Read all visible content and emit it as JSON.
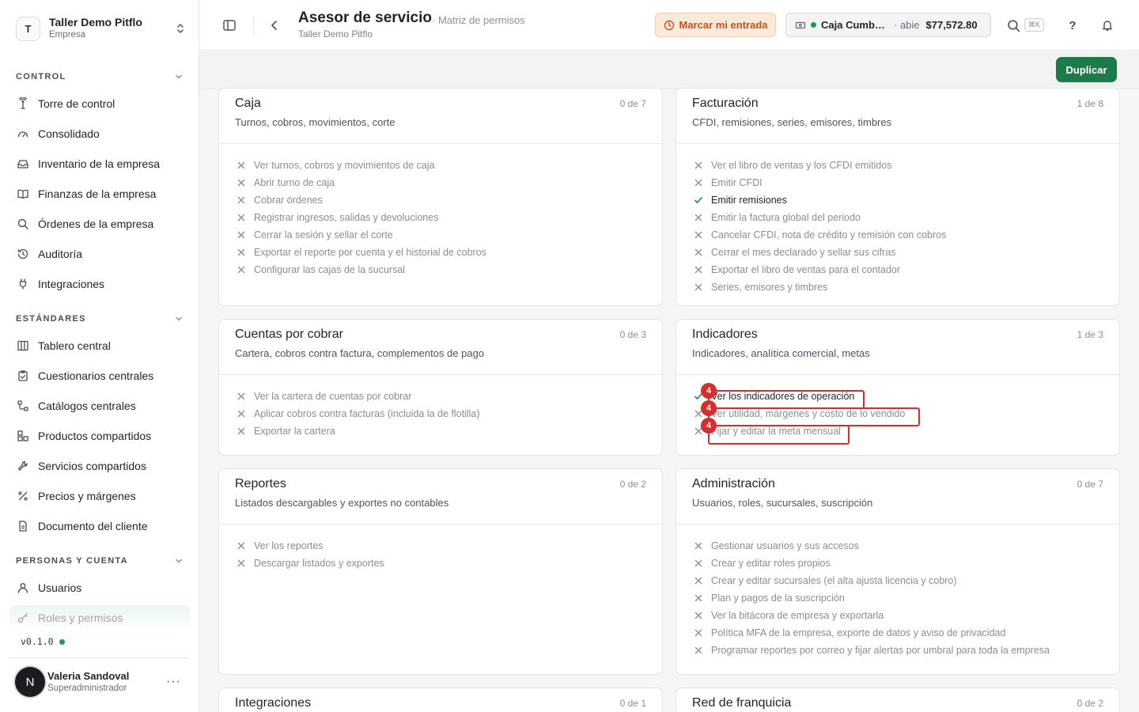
{
  "org": {
    "initial": "T",
    "name": "Taller Demo Pitflo",
    "type": "Empresa"
  },
  "sidebar": {
    "sections": [
      {
        "title": "CONTROL",
        "items": [
          "Torre de control",
          "Consolidado",
          "Inventario de la empresa",
          "Finanzas de la empresa",
          "Órdenes de la empresa",
          "Auditoría",
          "Integraciones"
        ]
      },
      {
        "title": "ESTÁNDARES",
        "items": [
          "Tablero central",
          "Cuestionarios centrales",
          "Catálogos centrales",
          "Productos compartidos",
          "Servicios compartidos",
          "Precios y márgenes",
          "Documento del cliente"
        ]
      },
      {
        "title": "PERSONAS Y CUENTA",
        "items": [
          "Usuarios",
          "Roles y permisos"
        ]
      }
    ],
    "version": "v0.1.0"
  },
  "user": {
    "initial": "N",
    "name": "Valeria Sandoval",
    "role": "Superadministrador"
  },
  "header": {
    "title": "Asesor de servicio",
    "subtitle": "Taller Demo Pitflo",
    "breadcrumb": "· Matriz de permisos",
    "clock_in": "Marcar mi entrada",
    "caja": {
      "name": "Caja Cumbres",
      "status": "· abie",
      "amount": "$77,572.80"
    },
    "shortcut": "⌘K",
    "help": "?"
  },
  "toolbar": {
    "duplicate": "Duplicar"
  },
  "cards": {
    "caja": {
      "title": "Caja",
      "count": "0 de 7",
      "desc": "Turnos, cobros, movimientos, corte",
      "perms": [
        "Ver turnos, cobros y movimientos de caja",
        "Abrir turno de caja",
        "Cobrar órdenes",
        "Registrar ingresos, salidas y devoluciones",
        "Cerrar la sesión y sellar el corte",
        "Exportar el reporte por cuenta y el historial de cobros",
        "Configurar las cajas de la sucursal"
      ]
    },
    "facturacion": {
      "title": "Facturación",
      "count": "1 de 8",
      "desc": "CFDI, remisiones, series, emisores, timbres",
      "perms": [
        "Ver el libro de ventas y los CFDI emitidos",
        "Emitir CFDI",
        "Emitir remisiones",
        "Emitir la factura global del periodo",
        "Cancelar CFDI, nota de crédito y remisión con cobros",
        "Cerrar el mes declarado y sellar sus cifras",
        "Exportar el libro de ventas para el contador",
        "Series, emisores y timbres"
      ]
    },
    "cxc": {
      "title": "Cuentas por cobrar",
      "count": "0 de 3",
      "desc": "Cartera, cobros contra factura, complementos de pago",
      "perms": [
        "Ver la cartera de cuentas por cobrar",
        "Aplicar cobros contra facturas (incluida la de flotilla)",
        "Exportar la cartera"
      ]
    },
    "indicadores": {
      "title": "Indicadores",
      "count": "1 de 3",
      "desc": "Indicadores, analítica comercial, metas",
      "perms": [
        "Ver los indicadores de operación",
        "Ver utilidad, márgenes y costo de lo vendido",
        "Fijar y editar la meta mensual"
      ]
    },
    "reportes": {
      "title": "Reportes",
      "count": "0 de 2",
      "desc": "Listados descargables y exportes no contables",
      "perms": [
        "Ver los reportes",
        "Descargar listados y exportes"
      ]
    },
    "admin": {
      "title": "Administración",
      "count": "0 de 7",
      "desc": "Usuarios, roles, sucursales, suscripción",
      "perms": [
        "Gestionar usuarios y sus accesos",
        "Crear y editar roles propios",
        "Crear y editar sucursales (el alta ajusta licencia y cobro)",
        "Plan y pagos de la suscripción",
        "Ver la bitácora de empresa y exportarla",
        "Política MFA de la empresa, exporte de datos y aviso de privacidad",
        "Programar reportes por correo y fijar alertas por umbral para toda la empresa"
      ]
    },
    "integraciones": {
      "title": "Integraciones",
      "count": "0 de 1"
    },
    "franquicia": {
      "title": "Red de franquicia",
      "count": "0 de 2"
    }
  },
  "annotations": {
    "badge": "4"
  },
  "colors": {
    "accent": "#1d7a4b",
    "clock_bg": "#fbe9da",
    "clock_text": "#c2531c",
    "highlight": "#d62e2e",
    "check": "#1d8a4e"
  }
}
